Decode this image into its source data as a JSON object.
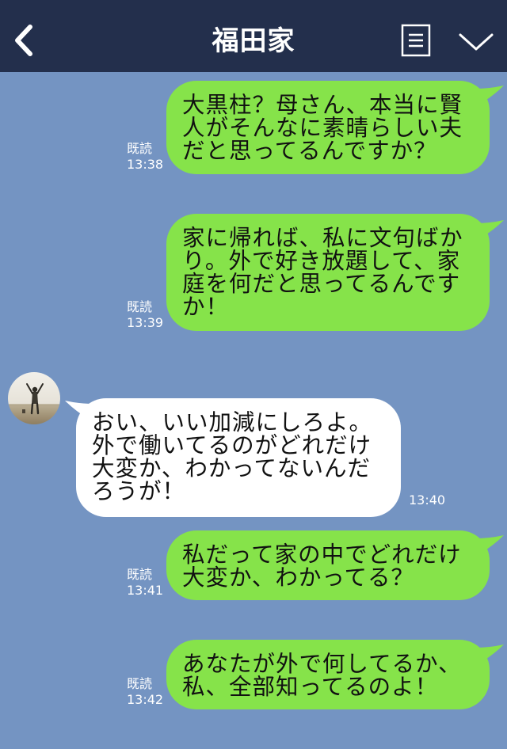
{
  "header": {
    "title": "福田家",
    "back_icon": "chevron-left-icon",
    "menu_icon": "note-list-icon",
    "collapse_icon": "chevron-down-icon",
    "bg_color": "#232f4c"
  },
  "colors": {
    "chat_bg": "#7494c2",
    "my_bubble": "#86e34a",
    "their_bubble": "#ffffff"
  },
  "messages": [
    {
      "sender": "me",
      "lines": [
        "大黒柱？母さん、本当に賢",
        "人がそんなに素晴らしい夫",
        "だと思ってるんですか？"
      ],
      "read": "既読",
      "time": "13:38"
    },
    {
      "sender": "me",
      "lines": [
        "家に帰れば、私に文句ばか",
        "り。外で好き放題して、家",
        "庭を何だと思ってるんです",
        "か！"
      ],
      "read": "既読",
      "time": "13:39"
    },
    {
      "sender": "other",
      "lines": [
        "おい、いい加減にしろよ。",
        "外で働いてるのがどれだけ",
        "大変か、わかってないんだ",
        "ろうが！"
      ],
      "time": "13:40"
    },
    {
      "sender": "me",
      "lines": [
        "私だって家の中でどれだけ",
        "大変か、わかってる？"
      ],
      "read": "既読",
      "time": "13:41"
    },
    {
      "sender": "me",
      "lines": [
        "あなたが外で何してるか、",
        "私、全部知ってるのよ！"
      ],
      "read": "既読",
      "time": "13:42"
    }
  ]
}
